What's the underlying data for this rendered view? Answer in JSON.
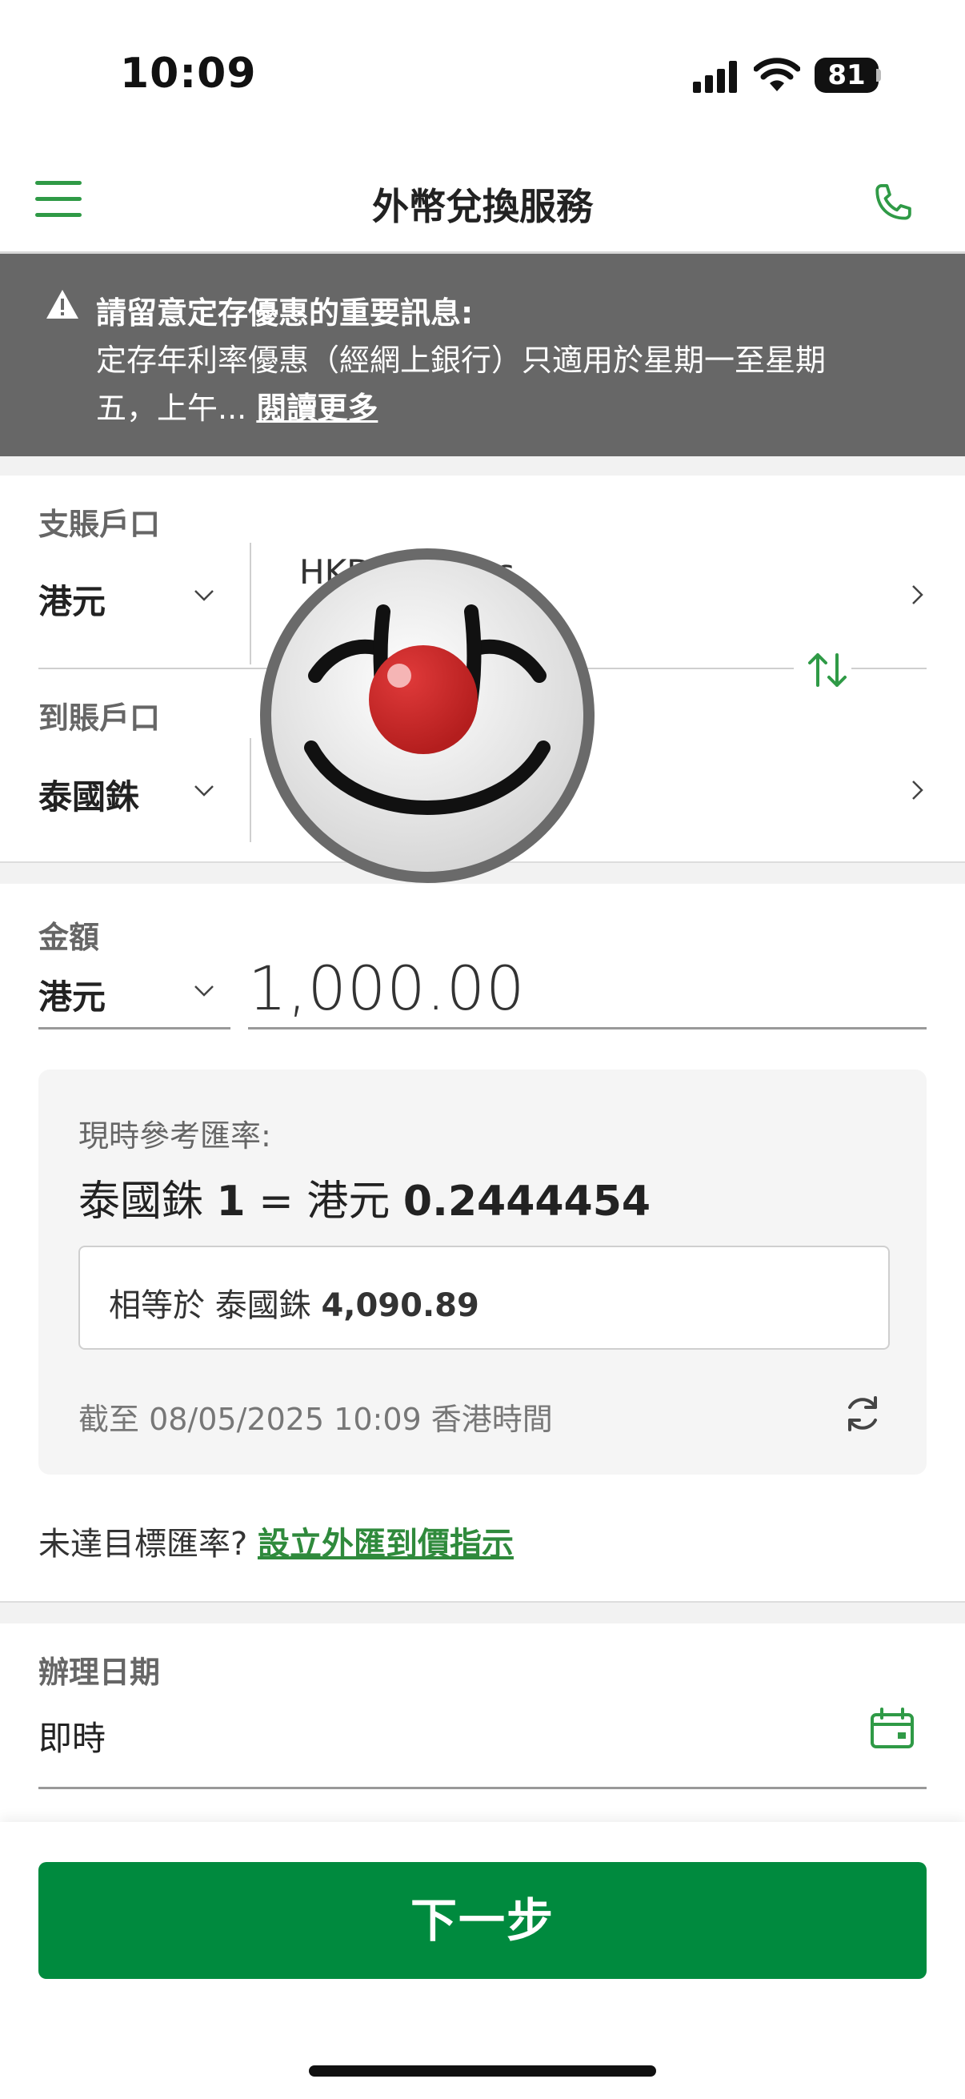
{
  "status_bar": {
    "time": "10:09",
    "battery": "81"
  },
  "header": {
    "title": "外幣兌換服務"
  },
  "notice": {
    "title": "請留意定存優惠的重要訊息:",
    "body": "定存年利率優惠（經網上銀行）只適用於星期一至星期五，上午...",
    "link": "閱讀更多"
  },
  "from_account": {
    "label": "支賬戶口",
    "currency": "港元",
    "account_name": "HKD Savings"
  },
  "to_account": {
    "label": "到賬戶口",
    "currency": "泰國銖",
    "account_name": ""
  },
  "amount": {
    "label": "金額",
    "currency": "港元",
    "value": "1,000.00"
  },
  "rate": {
    "label": "現時參考匯率:",
    "value_prefix": "泰國銖 ",
    "value_bold_1": "1",
    "value_mid": " = 港元 ",
    "value_bold_2": "0.2444454",
    "equiv_prefix": "相等於 泰國銖 ",
    "equiv_value": "4,090.89",
    "asof": "截至  08/05/2025 10:09 香港時間"
  },
  "target": {
    "text": "未達目標匯率? ",
    "link": "設立外匯到價指示"
  },
  "date": {
    "label": "辦理日期",
    "value": "即時"
  },
  "next_button": "下一步",
  "colors": {
    "brand_green": "#008a3e",
    "notice_bg": "#676767",
    "link_green": "#2f8a3c"
  },
  "icons": [
    "menu-icon",
    "phone-icon",
    "warning-icon",
    "chevron-down-icon",
    "chevron-right-icon",
    "swap-icon",
    "refresh-icon",
    "calendar-icon"
  ]
}
